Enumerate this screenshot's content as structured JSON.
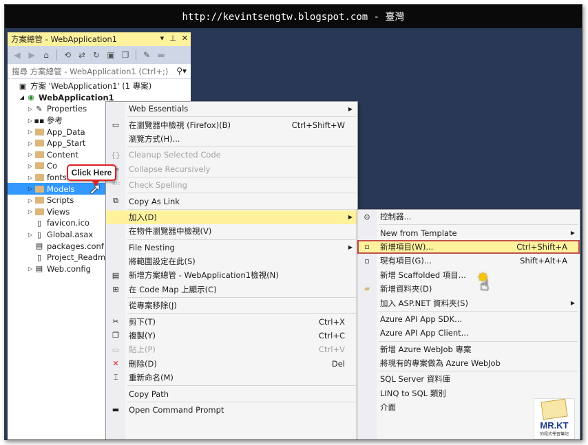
{
  "banner": {
    "text": "http://kevintsengtw.blogspot.com - 臺灣"
  },
  "solution_explorer": {
    "title": "方案總管 - WebApplication1",
    "search_placeholder": "搜尋 方案總管 - WebApplication1 (Ctrl+;)",
    "tree": [
      {
        "label": "方案 'WebApplication1' (1 專案)",
        "icon": "solution-icon",
        "indent": 0
      },
      {
        "label": "WebApplication1",
        "icon": "web-project-icon",
        "indent": 1,
        "bold": true
      },
      {
        "label": "Properties",
        "icon": "wrench-icon",
        "indent": 2
      },
      {
        "label": "參考",
        "icon": "references-icon",
        "indent": 2
      },
      {
        "label": "App_Data",
        "icon": "folder-icon",
        "indent": 2
      },
      {
        "label": "App_Start",
        "icon": "folder-icon",
        "indent": 2
      },
      {
        "label": "Content",
        "icon": "folder-icon",
        "indent": 2
      },
      {
        "label": "Co",
        "icon": "folder-icon",
        "indent": 2
      },
      {
        "label": "fonts",
        "icon": "folder-icon",
        "indent": 2
      },
      {
        "label": "Models",
        "icon": "folder-icon",
        "indent": 2,
        "selected": true
      },
      {
        "label": "Scripts",
        "icon": "folder-icon",
        "indent": 2
      },
      {
        "label": "Views",
        "icon": "folder-icon",
        "indent": 2
      },
      {
        "label": "favicon.ico",
        "icon": "file-icon",
        "indent": 2
      },
      {
        "label": "Global.asax",
        "icon": "file-icon",
        "indent": 2
      },
      {
        "label": "packages.conf",
        "icon": "config-file-icon",
        "indent": 2
      },
      {
        "label": "Project_Readm",
        "icon": "file-icon",
        "indent": 2
      },
      {
        "label": "Web.config",
        "icon": "config-file-icon",
        "indent": 2
      }
    ]
  },
  "callout": {
    "text": "Click Here"
  },
  "context_menu": {
    "items": [
      {
        "label": "Web Essentials",
        "submenu": true
      },
      {
        "sep": true
      },
      {
        "label": "在瀏覽器中檢視 (Firefox)(B)",
        "shortcut": "Ctrl+Shift+W",
        "icon": "browser-icon"
      },
      {
        "label": "瀏覽方式(H)..."
      },
      {
        "sep": true
      },
      {
        "label": "Cleanup Selected Code",
        "disabled": true,
        "icon": "braces-icon"
      },
      {
        "label": "Collapse Recursively",
        "disabled": true,
        "icon": "collapse-icon"
      },
      {
        "sep": true
      },
      {
        "label": "Check Spelling",
        "disabled": true,
        "icon": "spellcheck-icon"
      },
      {
        "sep": true
      },
      {
        "label": "Copy As Link",
        "icon": "copy-link-icon"
      },
      {
        "sep": true
      },
      {
        "label": "加入(D)",
        "submenu": true,
        "highlight": true
      },
      {
        "label": "在物件瀏覽器中檢視(V)"
      },
      {
        "sep": true
      },
      {
        "label": "File Nesting",
        "submenu": true
      },
      {
        "label": "將範圍設定在此(S)"
      },
      {
        "label": "新增方案總管 - WebApplication1檢視(N)",
        "icon": "new-view-icon"
      },
      {
        "label": "在 Code Map 上顯示(C)",
        "icon": "code-map-icon"
      },
      {
        "sep": true
      },
      {
        "label": "從專案移除(J)"
      },
      {
        "sep": true
      },
      {
        "label": "剪下(T)",
        "shortcut": "Ctrl+X",
        "icon": "scissors-icon"
      },
      {
        "label": "複製(Y)",
        "shortcut": "Ctrl+C",
        "icon": "copy-icon"
      },
      {
        "label": "貼上(P)",
        "shortcut": "Ctrl+V",
        "disabled": true,
        "icon": "paste-icon"
      },
      {
        "label": "刪除(D)",
        "shortcut": "Del",
        "icon": "delete-icon"
      },
      {
        "label": "重新命名(M)",
        "icon": "rename-icon"
      },
      {
        "sep": true
      },
      {
        "label": "Copy Path"
      },
      {
        "sep": true
      },
      {
        "label": "Open Command Prompt",
        "icon": "command-prompt-icon"
      }
    ]
  },
  "add_submenu": {
    "items": [
      {
        "label": "控制器...",
        "icon": "controller-icon"
      },
      {
        "sep": true
      },
      {
        "label": "New from Template",
        "submenu": true
      },
      {
        "label": "新增項目(W)...",
        "shortcut": "Ctrl+Shift+A",
        "hot": true,
        "icon": "new-item-icon"
      },
      {
        "label": "現有項目(G)...",
        "shortcut": "Shift+Alt+A",
        "icon": "existing-item-icon"
      },
      {
        "label": "新增 Scaffolded 項目..."
      },
      {
        "label": "新增資料夾(D)",
        "icon": "new-folder-icon"
      },
      {
        "label": "加入 ASP.NET 資料夾(S)",
        "submenu": true
      },
      {
        "sep": true
      },
      {
        "label": "Azure API App SDK..."
      },
      {
        "label": "Azure API App Client..."
      },
      {
        "sep": true
      },
      {
        "label": "新增 Azure WebJob 專案"
      },
      {
        "label": "將現有的專案做為 Azure WebJob"
      },
      {
        "sep": true
      },
      {
        "label": "SQL Server 資料庫"
      },
      {
        "label": "LINQ to SQL 類別"
      },
      {
        "label": "介面"
      }
    ]
  },
  "logo": {
    "title": "MR.KT",
    "subtitle": "的程式學習筆記"
  }
}
